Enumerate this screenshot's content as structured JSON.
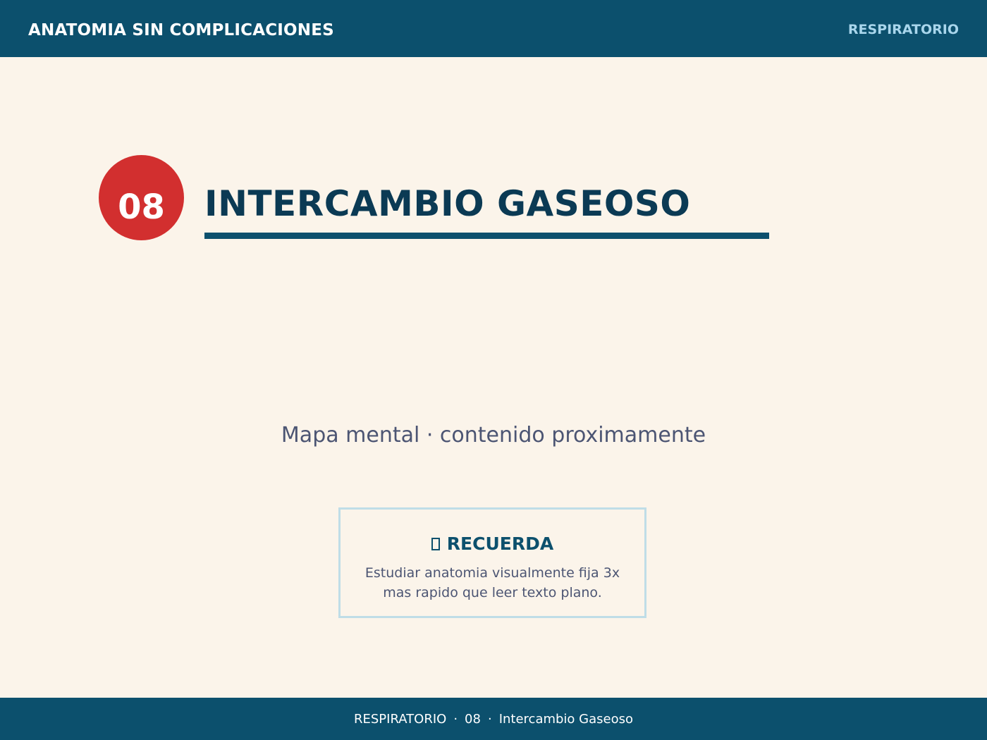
{
  "header": {
    "title": "ANATOMIA SIN COMPLICACIONES",
    "section": "RESPIRATORIO"
  },
  "slide": {
    "number": "08",
    "title": "INTERCAMBIO GASEOSO",
    "subtitle": "Mapa mental · contenido proximamente"
  },
  "tip": {
    "icon": "square-box-icon",
    "heading": "RECUERDA",
    "body": "Estudiar anatomia visualmente fija 3x mas rapido que leer texto plano."
  },
  "footer": {
    "section": "RESPIRATORIO",
    "separator": "·",
    "number": "08",
    "topic": "Intercambio Gaseoso"
  },
  "colors": {
    "header_bg": "#0C506D",
    "page_bg": "#FBF4EA",
    "badge": "#D22F2F",
    "title": "#0B3A54",
    "accent_light": "#A9D6EC",
    "tip_border": "#BFDDE7",
    "body_text": "#4C5573"
  }
}
